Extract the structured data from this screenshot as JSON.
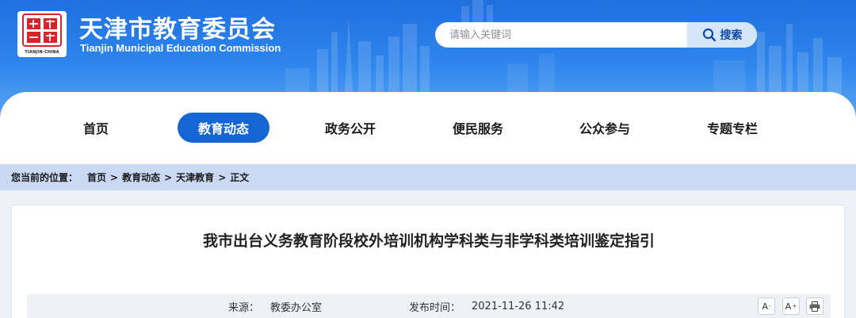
{
  "header": {
    "logo_seal_text": "天津",
    "logo_caption": "TIANJIN·CHINA",
    "title": "天津市教育委员会",
    "subtitle": "Tianjin Municipal Education Commission"
  },
  "search": {
    "placeholder": "请输入关键词",
    "button_label": "搜索",
    "icon": "search-icon"
  },
  "nav": {
    "items": [
      {
        "label": "首页",
        "active": false
      },
      {
        "label": "教育动态",
        "active": true
      },
      {
        "label": "政务公开",
        "active": false
      },
      {
        "label": "便民服务",
        "active": false
      },
      {
        "label": "公众参与",
        "active": false
      },
      {
        "label": "专题专栏",
        "active": false
      }
    ],
    "active_color": "#1565d4"
  },
  "breadcrumb": {
    "prefix": "您当前的位置：",
    "items": [
      "首页",
      "教育动态",
      "天津教育",
      "正文"
    ],
    "separator": ">"
  },
  "article": {
    "title": "我市出台义务教育阶段校外培训机构学科类与非学科类培训鉴定指引",
    "source_label": "来源：",
    "source_value": "教委办公室",
    "date_label": "发布时间：",
    "date_value": "2021-11-26 11:42",
    "tools": {
      "font_decrease": "A",
      "font_decrease_mark": "-",
      "font_increase": "A",
      "font_increase_mark": "+",
      "print_icon": "print-icon"
    }
  },
  "colors": {
    "banner": "#2f86ec",
    "breadcrumb_bg": "#c9d9f3",
    "brand_blue": "#1565d4",
    "logo_red": "#d8232a"
  }
}
